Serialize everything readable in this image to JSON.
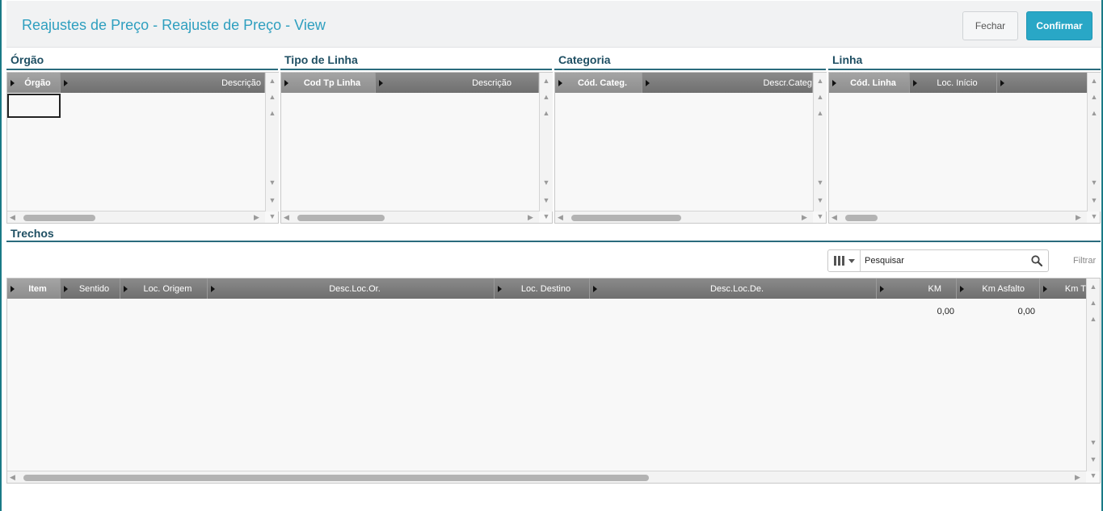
{
  "header": {
    "title": "Reajustes de Preço - Reajuste de Preço - View",
    "close_label": "Fechar",
    "confirm_label": "Confirmar"
  },
  "sections": {
    "orgao": {
      "title": "Órgão",
      "columns": [
        "Órgão",
        "Descrição"
      ]
    },
    "tipo_linha": {
      "title": "Tipo de Linha",
      "columns": [
        "Cod Tp Linha",
        "Descrição"
      ]
    },
    "categoria": {
      "title": "Categoria",
      "columns": [
        "Cód. Categ.",
        "Descr.Categ"
      ]
    },
    "linha": {
      "title": "Linha",
      "columns": [
        "Cód. Linha",
        "Loc. Início"
      ]
    },
    "trechos": {
      "title": "Trechos",
      "search_placeholder": "Pesquisar",
      "filter_label": "Filtrar",
      "columns": [
        "Item",
        "Sentido",
        "Loc. Origem",
        "Desc.Loc.Or.",
        "Loc. Destino",
        "Desc.Loc.De.",
        "KM",
        "Km Asfalto",
        "Km T"
      ],
      "rows": [
        {
          "km": "0,00",
          "km_asfalto": "0,00"
        }
      ]
    }
  },
  "icons": {
    "columns_icon": "columns-icon",
    "search_icon": "search-icon",
    "scroll_up": "chevron-up-icon",
    "scroll_down": "chevron-down-icon"
  },
  "colors": {
    "accent": "#29a7c6",
    "title": "#2e9fbf",
    "section_title": "#1f4f63",
    "frame": "#1a7a86"
  }
}
